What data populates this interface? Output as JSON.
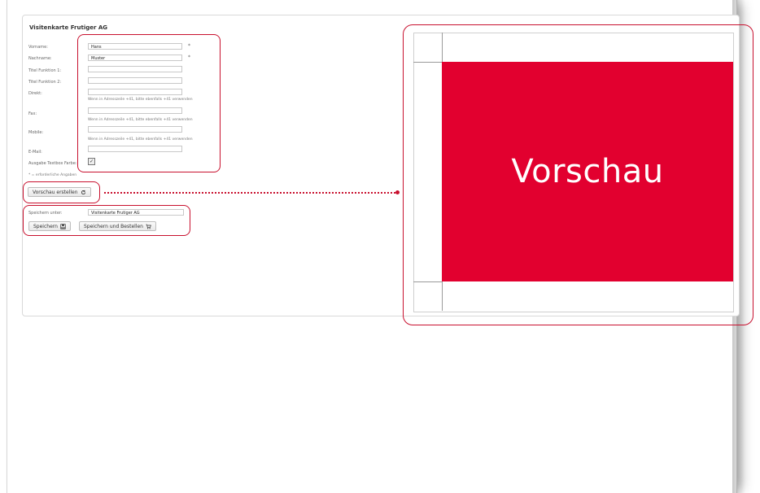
{
  "form": {
    "title": "Visitenkarte Frutiger AG",
    "fields": [
      {
        "label": "Vorname:",
        "value": "Hans",
        "required": "*"
      },
      {
        "label": "Nachname:",
        "value": "Muster",
        "required": "*"
      },
      {
        "label": "Titel Funktion 1:",
        "value": ""
      },
      {
        "label": "Titel Funktion 2:",
        "value": ""
      },
      {
        "label": "Direkt:",
        "value": "",
        "hint": "Wenn in Adresszeile +41, bitte ebenfalls +41 verwenden"
      },
      {
        "label": "Fax:",
        "value": "",
        "hint": "Wenn in Adresszeile +41, bitte ebenfalls +41 verwenden"
      },
      {
        "label": "Mobile:",
        "value": "",
        "hint": "Wenn in Adresszeile +41, bitte ebenfalls +41 verwenden"
      },
      {
        "label": "E-Mail:",
        "value": ""
      },
      {
        "label": "Ausgabe Textbox Farbe:",
        "checkbox": "✓"
      }
    ],
    "required_note": "* = erforderliche Angaben"
  },
  "actions": {
    "preview_button": "Vorschau erstellen",
    "save_as_label": "Speichern unter:",
    "save_as_value": "Visitenkarte Frutiger AG",
    "save_button": "Speichern",
    "save_order_button": "Speichern und Bestellen"
  },
  "preview": {
    "card_text": "Vorschau",
    "card_color": "#e2002f"
  },
  "colors": {
    "highlight": "#c8102e"
  }
}
